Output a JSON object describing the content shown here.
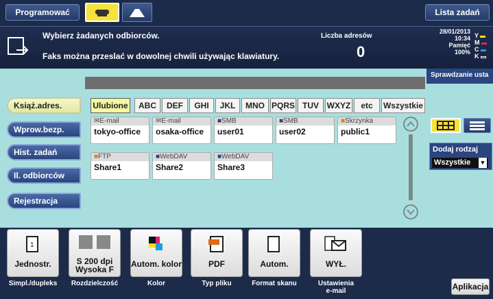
{
  "topbar": {
    "program_label": "Programować",
    "list_label": "Lista zadań"
  },
  "message": {
    "line1": "Wybierz żadanych odbiorców.",
    "line2": "Faks można przeslać w dowolnej chwili używając klawiatury.",
    "count_label": "Liczba adresów",
    "count_value": "0",
    "date": "28/01/2013",
    "time": "10:34",
    "memory_label": "Pamięć",
    "memory_value": "100%",
    "toner": [
      "Y",
      "M",
      "C",
      "K"
    ],
    "check_label": "Sprawdzanie usta"
  },
  "sidebar": {
    "items": [
      {
        "label": "Książ.adres."
      },
      {
        "label": "Wprow.bezp."
      },
      {
        "label": "Hist. zadań"
      },
      {
        "label": "Il. odbiorców"
      },
      {
        "label": "Rejestracja"
      }
    ]
  },
  "tabs": [
    "Ulubione",
    "ABC",
    "DEF",
    "GHI",
    "JKL",
    "MNO",
    "PQRS",
    "TUV",
    "WXYZ",
    "etc",
    "Wszystkie"
  ],
  "entries": [
    {
      "type": "E-mail",
      "name": "tokyo-office"
    },
    {
      "type": "E-mail",
      "name": "osaka-office"
    },
    {
      "type": "SMB",
      "name": "user01"
    },
    {
      "type": "SMB",
      "name": "user02"
    },
    {
      "type": "Skrzynka",
      "name": "public1"
    },
    {
      "type": "FTP",
      "name": "Share1"
    },
    {
      "type": "WebDAV",
      "name": "Share2"
    },
    {
      "type": "WebDAV",
      "name": "Share3"
    }
  ],
  "filter": {
    "label": "Dodaj rodzaj",
    "value": "Wszystkie"
  },
  "functions": [
    {
      "label": "Jednostr.",
      "caption": "Simpl./dupleks",
      "icon": "simplex-icon"
    },
    {
      "label": "S 200 dpi\nWysoka F",
      "caption": "Rozdzielczość",
      "icon": "resolution-icon"
    },
    {
      "label": "Autom. kolor",
      "caption": "Kolor",
      "icon": "color-icon"
    },
    {
      "label": "PDF",
      "caption": "Typ pliku",
      "icon": "pdf-icon"
    },
    {
      "label": "Autom.",
      "caption": "Format skanu",
      "icon": "page-icon"
    },
    {
      "label": "WYŁ.",
      "caption": "Ustawienia\ne-mail",
      "icon": "email-settings-icon"
    }
  ],
  "app_button": "Aplikacja"
}
